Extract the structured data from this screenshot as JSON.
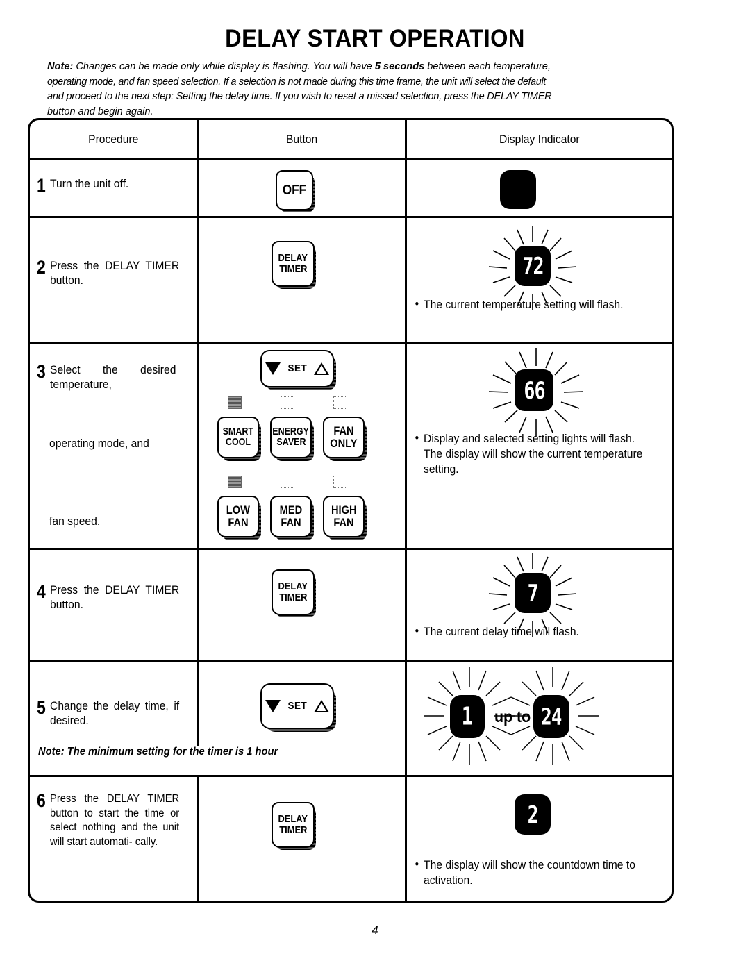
{
  "document": {
    "title": "DELAY START OPERATION",
    "page_number": "4"
  },
  "intro_note": {
    "lead": "Note:",
    "line1_a": " Changes can be made only while display is flashing.  You will have ",
    "line1_bold": "5 seconds",
    "line1_b": " between each temperature,",
    "line2": "operating mode, and fan speed selection.  If a selection is not made during this time frame, the unit will select the default",
    "line3": "and proceed to the next step:  Setting the delay time.  If you wish to reset a missed selection, press the DELAY TIMER",
    "line4": "button and begin again."
  },
  "table": {
    "headers": {
      "procedure": "Procedure",
      "button": "Button",
      "display_indicator": "Display Indicator"
    },
    "rows": [
      {
        "number": "1",
        "procedure": "Turn the unit off.",
        "button_label": "OFF",
        "display_value": "",
        "display_caption": ""
      },
      {
        "number": "2",
        "procedure": "Press the DELAY TIMER button.",
        "button_line1": "DELAY",
        "button_line2": "TIMER",
        "display_value": "72",
        "display_caption": "The current temperature setting will flash."
      },
      {
        "number": "3",
        "procedure_line1": "Select the desired temperature,",
        "procedure_line2": "operating mode, and",
        "procedure_line3": "fan speed.",
        "set_button": {
          "down": "▽",
          "label": "SET",
          "up": "△"
        },
        "mode_buttons": [
          {
            "line1": "SMART",
            "line2": "COOL",
            "indicator": "on"
          },
          {
            "line1": "ENERGY",
            "line2": "SAVER",
            "indicator": "off"
          },
          {
            "line1": "FAN",
            "line2": "ONLY",
            "indicator": "off"
          }
        ],
        "fan_buttons": [
          {
            "line1": "LOW",
            "line2": "FAN",
            "indicator": "on"
          },
          {
            "line1": "MED",
            "line2": "FAN",
            "indicator": "off"
          },
          {
            "line1": "HIGH",
            "line2": "FAN",
            "indicator": "off"
          }
        ],
        "display_value": "66",
        "display_caption": "Display and selected setting lights will flash. The display will show the current temperature setting."
      },
      {
        "number": "4",
        "procedure": "Press the DELAY TIMER button.",
        "button_line1": "DELAY",
        "button_line2": "TIMER",
        "display_value": "7",
        "display_caption": "The current delay time will flash."
      },
      {
        "number": "5",
        "procedure": "Change the delay time, if desired.",
        "set_button": {
          "down": "▽",
          "label": "SET",
          "up": "△"
        },
        "row_note": "Note:  The minimum setting for the timer is 1 hour",
        "display_value_min": "1",
        "display_between": "up to",
        "display_value_max": "24"
      },
      {
        "number": "6",
        "procedure": "Press the DELAY TIMER button to start the time or select nothing and the unit will start automati- cally.",
        "button_line1": "DELAY",
        "button_line2": "TIMER",
        "display_value": "2",
        "display_caption": "The display will show the countdown time to activation."
      }
    ]
  },
  "colors": {
    "ink": "#000000",
    "paper": "#ffffff",
    "lcd_background": "#000000",
    "lcd_digit": "#ffffff"
  }
}
